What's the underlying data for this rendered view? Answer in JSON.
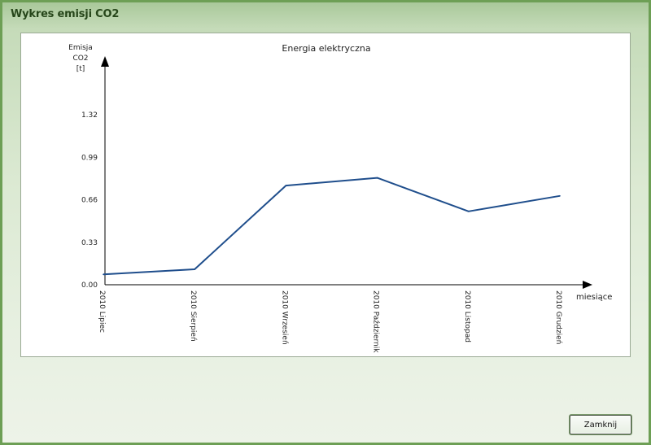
{
  "window": {
    "title": "Wykres emisji CO2",
    "close_label": "Zamknij"
  },
  "chart_data": {
    "type": "line",
    "title": "Energia elektryczna",
    "ylabel": [
      "Emisja",
      "CO2",
      "[t]"
    ],
    "xlabel": "miesiące",
    "yticks": [
      "0.00",
      "0.33",
      "0.66",
      "0.99",
      "1.32"
    ],
    "ylim": [
      0,
      1.32
    ],
    "categories": [
      "2010 Lipiec",
      "2010 Sierpień",
      "2010 Wrzesień",
      "2010 Październik",
      "2010 Listopad",
      "2010 Grudzień"
    ],
    "series": [
      {
        "values": [
          0.08,
          0.12,
          0.77,
          0.83,
          0.57,
          0.69
        ]
      }
    ],
    "line_color": "#1f4e8c",
    "grid": false
  }
}
